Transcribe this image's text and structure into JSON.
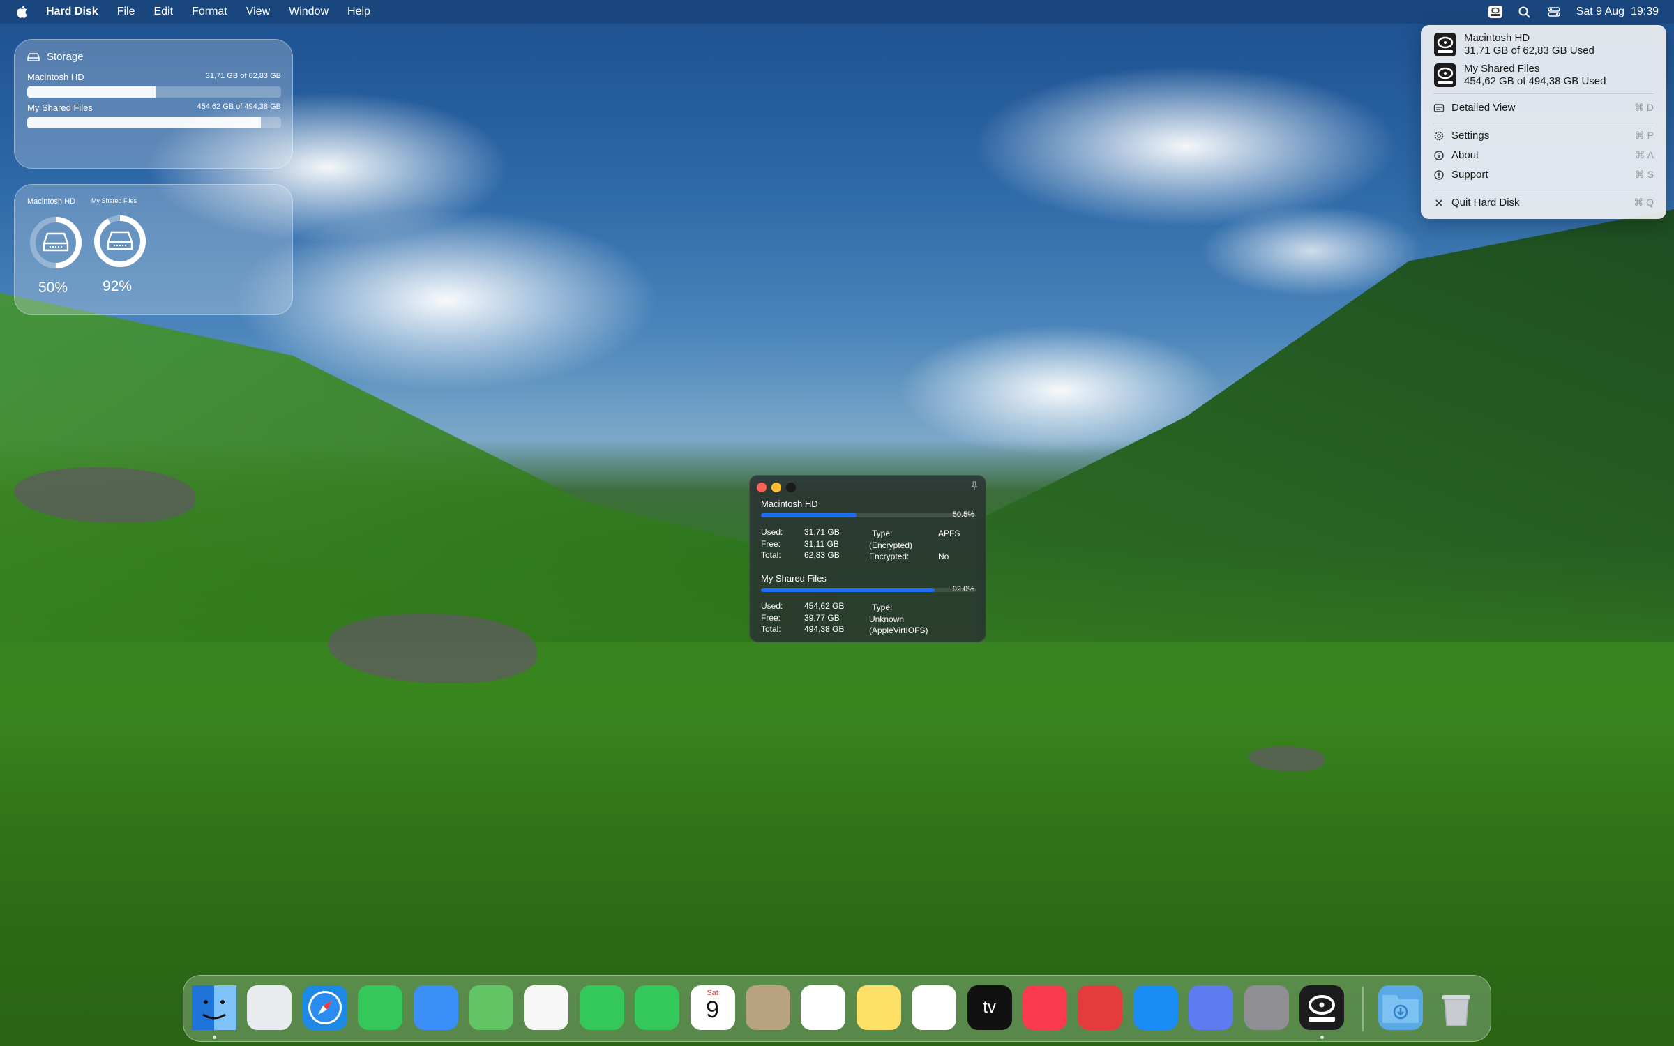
{
  "menubar": {
    "app_name": "Hard Disk",
    "menus": [
      "File",
      "Edit",
      "Format",
      "View",
      "Window",
      "Help"
    ],
    "clock": "Sat 9 Aug  19:39",
    "icons": [
      "hard-disk-icon",
      "search-icon",
      "control-center-icon"
    ]
  },
  "storage_widget": {
    "title": "Storage",
    "disks": [
      {
        "name": "Macintosh HD",
        "usage": "31,71 GB of 62,83 GB",
        "fill_fraction": 0.505
      },
      {
        "name": "My Shared Files",
        "usage": "454,62 GB of 494,38 GB",
        "fill_fraction": 0.92
      }
    ]
  },
  "ring_widget": {
    "disks": [
      {
        "name": "Macintosh HD",
        "percent": "50%",
        "fill_fraction": 0.5
      },
      {
        "name": "My Shared Files",
        "percent": "92%",
        "fill_fraction": 0.92
      }
    ]
  },
  "menu_dropdown": {
    "disks": [
      {
        "name": "Macintosh HD",
        "usage": "31,71 GB of 62,83 GB Used"
      },
      {
        "name": "My Shared Files",
        "usage": "454,62 GB of 494,38 GB Used"
      }
    ],
    "items": [
      {
        "label": "Detailed View",
        "shortcut": "⌘ D",
        "icon": "detailed-view-icon"
      },
      {
        "label": "Settings",
        "shortcut": "⌘ P",
        "icon": "gear-icon"
      },
      {
        "label": "About",
        "shortcut": "⌘ A",
        "icon": "info-icon"
      },
      {
        "label": "Support",
        "shortcut": "⌘ S",
        "icon": "support-icon"
      },
      {
        "label": "Quit Hard Disk",
        "shortcut": "⌘ Q",
        "icon": "close-icon"
      }
    ]
  },
  "detail_window": {
    "disks": [
      {
        "name": "Macintosh HD",
        "percent": "50.5%",
        "fill_fraction": 0.505,
        "used_label": "Used:",
        "used": "31,71 GB",
        "free_label": "Free:",
        "free": "31,11 GB",
        "total_label": "Total:",
        "total": "62,83 GB",
        "type_label": "Type:",
        "type": "APFS",
        "type_extra": "(Encrypted)",
        "encrypted_label": "Encrypted:",
        "encrypted": "No"
      },
      {
        "name": "My Shared Files",
        "percent": "92.0%",
        "fill_fraction": 0.92,
        "used_label": "Used:",
        "used": "454,62 GB",
        "free_label": "Free:",
        "free": "39,77 GB",
        "total_label": "Total:",
        "total": "494,38 GB",
        "type_label": "Type:",
        "type": "Unknown",
        "type_extra": "(AppleVirtIOFS)"
      }
    ]
  },
  "dock": {
    "calendar_month": "Sat",
    "calendar_day": "9",
    "tv_label": "tv",
    "apps": [
      {
        "name": "Finder",
        "color": "#2f8ff0",
        "running": true
      },
      {
        "name": "Launchpad",
        "color": "#e9ecef",
        "running": false
      },
      {
        "name": "Safari",
        "color": "#1e88e5",
        "running": false
      },
      {
        "name": "Messages",
        "color": "#35c759",
        "running": false
      },
      {
        "name": "Mail",
        "color": "#3a8ef6",
        "running": false
      },
      {
        "name": "Maps",
        "color": "#63c466",
        "running": false
      },
      {
        "name": "Photos",
        "color": "#f7f7f7",
        "running": false
      },
      {
        "name": "FaceTime",
        "color": "#34c759",
        "running": false
      },
      {
        "name": "Phone",
        "color": "#34c759",
        "running": false
      },
      {
        "name": "Calendar",
        "color": "#ffffff",
        "running": false
      },
      {
        "name": "Contacts",
        "color": "#b9a27f",
        "running": false
      },
      {
        "name": "Reminders",
        "color": "#ffffff",
        "running": false
      },
      {
        "name": "Notes",
        "color": "#fde068",
        "running": false
      },
      {
        "name": "Freeform",
        "color": "#ffffff",
        "running": false
      },
      {
        "name": "TV",
        "color": "#111111",
        "running": false
      },
      {
        "name": "Music",
        "color": "#fa3b4f",
        "running": false
      },
      {
        "name": "Rocket Typist",
        "color": "#e63b3b",
        "running": false
      },
      {
        "name": "App Store",
        "color": "#1a8cf5",
        "running": false
      },
      {
        "name": "iPhone Mirroring",
        "color": "#5c7cf0",
        "running": false
      },
      {
        "name": "System Settings",
        "color": "#8e8e93",
        "running": false
      },
      {
        "name": "Hard Disk",
        "color": "#1c1c1e",
        "running": true
      },
      {
        "name": "Downloads",
        "color": "#5aa9e6",
        "running": false
      },
      {
        "name": "Trash",
        "color": "#c9cdd2",
        "running": false
      }
    ]
  }
}
